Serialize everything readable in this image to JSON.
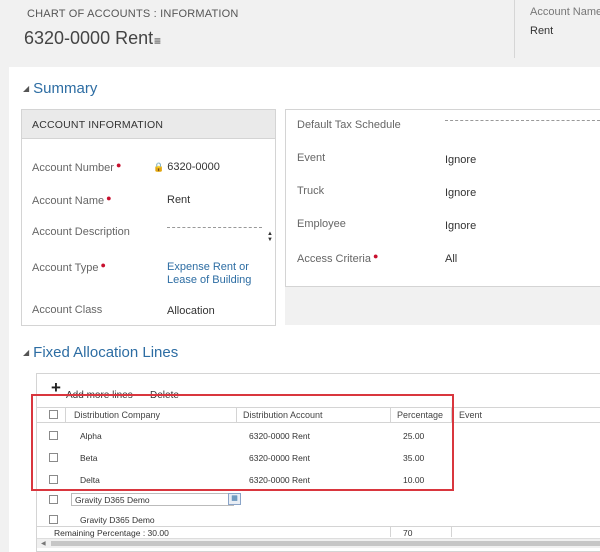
{
  "header": {
    "entity_label": "CHART OF ACCOUNTS : INFORMATION",
    "record_title": "6320-0000 Rent",
    "menu_icon": "list-menu-icon",
    "account_name_label": "Account Name",
    "account_name_value": "Rent"
  },
  "summary": {
    "title": "Summary",
    "account_info": {
      "heading": "ACCOUNT INFORMATION",
      "account_number_label": "Account Number",
      "account_number_value": "6320-0000",
      "account_name_label": "Account Name",
      "account_name_value": "Rent",
      "account_description_label": "Account Description",
      "account_type_label": "Account Type",
      "account_type_value_line1": "Expense Rent or",
      "account_type_value_line2": "Lease of Building",
      "account_class_label": "Account Class",
      "account_class_value": "Allocation"
    },
    "right_panel": {
      "default_tax_schedule_label": "Default Tax Schedule",
      "event_label": "Event",
      "event_value": "Ignore",
      "truck_label": "Truck",
      "truck_value": "Ignore",
      "employee_label": "Employee",
      "employee_value": "Ignore",
      "access_criteria_label": "Access Criteria",
      "access_criteria_value": "All"
    }
  },
  "allocation": {
    "title": "Fixed Allocation Lines",
    "add_more_lines": "Add more lines",
    "delete": "Delete",
    "columns": [
      "Distribution Company",
      "Distribution Account",
      "Percentage",
      "Event"
    ],
    "rows": [
      {
        "company": "Alpha",
        "account": "6320-0000 Rent",
        "percentage": "25.00"
      },
      {
        "company": "Beta",
        "account": "6320-0000 Rent",
        "percentage": "35.00"
      },
      {
        "company": "Delta",
        "account": "6320-0000 Rent",
        "percentage": "10.00"
      }
    ],
    "new_row_input": "Gravity D365 Demo",
    "default_row_company": "Gravity D365 Demo",
    "remaining_label": "Remaining Percentage : 30.00",
    "remaining_total": "70"
  },
  "colors": {
    "link": "#2d6da3",
    "required": "#c8102e",
    "highlight_border": "#d9363e"
  }
}
